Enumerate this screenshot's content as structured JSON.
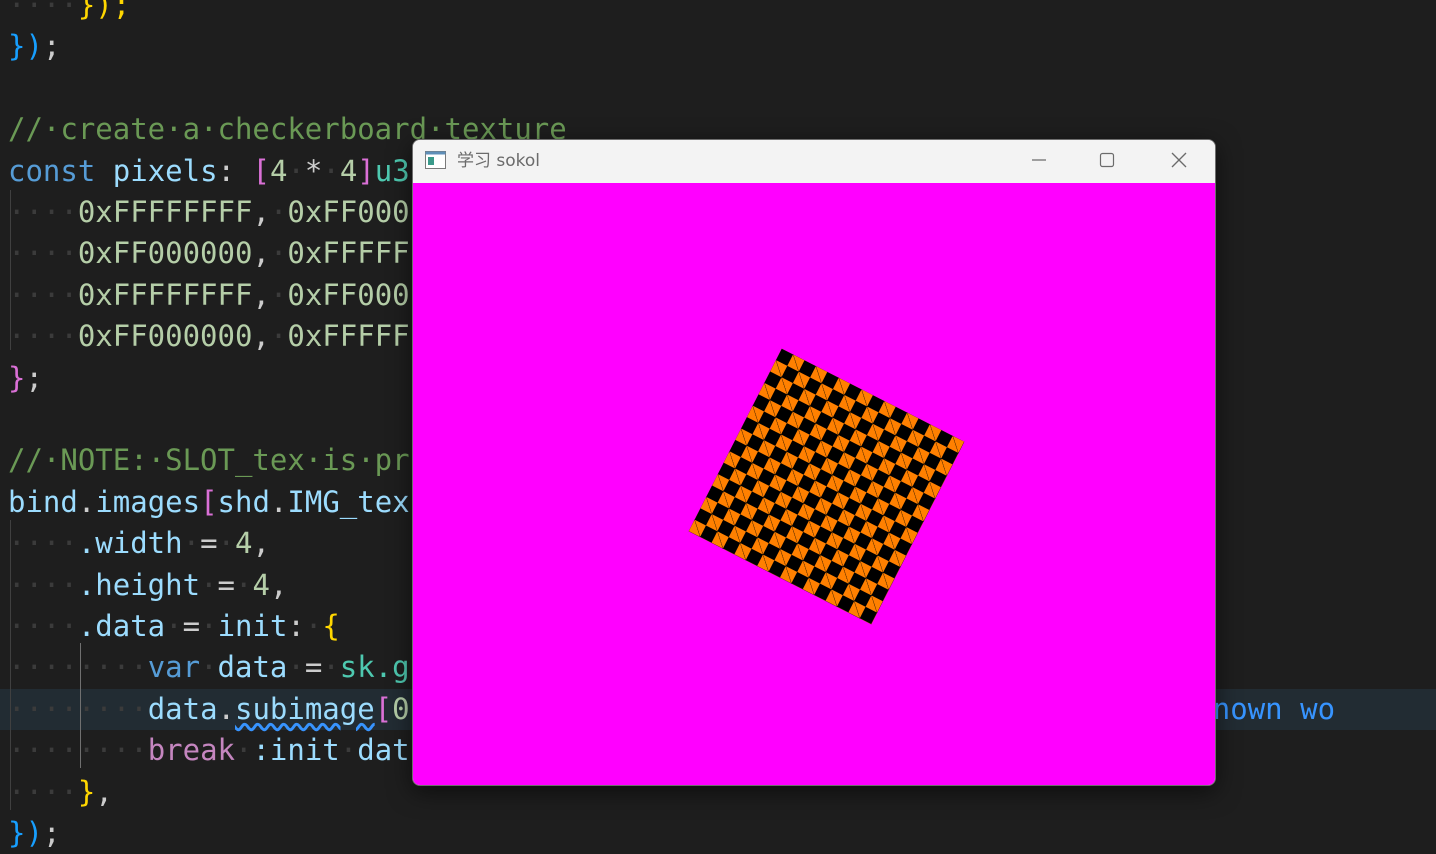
{
  "editor": {
    "lines": [
      [
        {
          "t": "····",
          "c": "ws"
        },
        {
          "t": "});",
          "c": "bracket-yellow"
        }
      ],
      [
        {
          "t": "}",
          "c": "bracket-blue"
        },
        {
          "t": ")",
          "c": "bracket-blue"
        },
        {
          "t": ";",
          "c": "punct"
        }
      ],
      [],
      [
        {
          "t": "//·create·a·checkerboard·texture",
          "c": "comment"
        }
      ],
      [
        {
          "t": "const",
          "c": "kw"
        },
        {
          "t": " ",
          "c": "ws"
        },
        {
          "t": "pixels",
          "c": "ident"
        },
        {
          "t": ":",
          "c": "punct"
        },
        {
          "t": " ",
          "c": "ws"
        },
        {
          "t": "[",
          "c": "bracket-pink"
        },
        {
          "t": "4",
          "c": "num"
        },
        {
          "t": "·",
          "c": "ws"
        },
        {
          "t": "*",
          "c": "punct"
        },
        {
          "t": "·",
          "c": "ws"
        },
        {
          "t": "4",
          "c": "num"
        },
        {
          "t": "]",
          "c": "bracket-pink"
        },
        {
          "t": "u3",
          "c": "type"
        }
      ],
      [
        {
          "t": "····",
          "c": "ws"
        },
        {
          "t": "0xFFFFFFFF",
          "c": "num"
        },
        {
          "t": ",",
          "c": "punct"
        },
        {
          "t": "·",
          "c": "ws"
        },
        {
          "t": "0xFF000",
          "c": "num"
        }
      ],
      [
        {
          "t": "····",
          "c": "ws"
        },
        {
          "t": "0xFF000000",
          "c": "num"
        },
        {
          "t": ",",
          "c": "punct"
        },
        {
          "t": "·",
          "c": "ws"
        },
        {
          "t": "0xFFFFF",
          "c": "num"
        }
      ],
      [
        {
          "t": "····",
          "c": "ws"
        },
        {
          "t": "0xFFFFFFFF",
          "c": "num"
        },
        {
          "t": ",",
          "c": "punct"
        },
        {
          "t": "·",
          "c": "ws"
        },
        {
          "t": "0xFF000",
          "c": "num"
        }
      ],
      [
        {
          "t": "····",
          "c": "ws"
        },
        {
          "t": "0xFF000000",
          "c": "num"
        },
        {
          "t": ",",
          "c": "punct"
        },
        {
          "t": "·",
          "c": "ws"
        },
        {
          "t": "0xFFFFF",
          "c": "num"
        }
      ],
      [
        {
          "t": "}",
          "c": "bracket-pink"
        },
        {
          "t": ";",
          "c": "punct"
        }
      ],
      [],
      [
        {
          "t": "//·NOTE:·SLOT_tex·is·pr",
          "c": "comment"
        }
      ],
      [
        {
          "t": "bind",
          "c": "ident"
        },
        {
          "t": ".",
          "c": "punct"
        },
        {
          "t": "images",
          "c": "ident"
        },
        {
          "t": "[",
          "c": "bracket-pink"
        },
        {
          "t": "shd",
          "c": "ident"
        },
        {
          "t": ".",
          "c": "punct"
        },
        {
          "t": "IMG_tex",
          "c": "ident"
        }
      ],
      [
        {
          "t": "····",
          "c": "ws"
        },
        {
          "t": ".width",
          "c": "ident"
        },
        {
          "t": "·",
          "c": "ws"
        },
        {
          "t": "=",
          "c": "punct"
        },
        {
          "t": "·",
          "c": "ws"
        },
        {
          "t": "4",
          "c": "num"
        },
        {
          "t": ",",
          "c": "punct"
        }
      ],
      [
        {
          "t": "····",
          "c": "ws"
        },
        {
          "t": ".height",
          "c": "ident"
        },
        {
          "t": "·",
          "c": "ws"
        },
        {
          "t": "=",
          "c": "punct"
        },
        {
          "t": "·",
          "c": "ws"
        },
        {
          "t": "4",
          "c": "num"
        },
        {
          "t": ",",
          "c": "punct"
        }
      ],
      [
        {
          "t": "····",
          "c": "ws"
        },
        {
          "t": ".data",
          "c": "ident"
        },
        {
          "t": "·",
          "c": "ws"
        },
        {
          "t": "=",
          "c": "punct"
        },
        {
          "t": "·",
          "c": "ws"
        },
        {
          "t": "init",
          "c": "ident"
        },
        {
          "t": ":",
          "c": "punct"
        },
        {
          "t": "·",
          "c": "ws"
        },
        {
          "t": "{",
          "c": "bracket-yellow"
        }
      ],
      [
        {
          "t": "········",
          "c": "ws"
        },
        {
          "t": "var",
          "c": "kw"
        },
        {
          "t": "·",
          "c": "ws"
        },
        {
          "t": "data",
          "c": "ident"
        },
        {
          "t": "·",
          "c": "ws"
        },
        {
          "t": "=",
          "c": "punct"
        },
        {
          "t": "·",
          "c": "ws"
        },
        {
          "t": "sk",
          "c": "type"
        },
        {
          "t": ".g",
          "c": "type"
        }
      ],
      [
        {
          "t": "········",
          "c": "ws"
        },
        {
          "t": "data",
          "c": "ident"
        },
        {
          "t": ".",
          "c": "punct"
        },
        {
          "t": "subimage",
          "c": "ident",
          "sq": true
        },
        {
          "t": "[",
          "c": "bracket-pink"
        },
        {
          "t": "0",
          "c": "num"
        },
        {
          "t": "                                        ",
          "c": "ws"
        },
        {
          "t": "\"",
          "c": "punct"
        },
        {
          "t": ":",
          "c": "error"
        },
        {
          "t": " ",
          "c": "ws"
        },
        {
          "t": "Unknown",
          "c": "error"
        },
        {
          "t": " ",
          "c": "ws"
        },
        {
          "t": "wo",
          "c": "error"
        }
      ],
      [
        {
          "t": "········",
          "c": "ws"
        },
        {
          "t": "break",
          "c": "ctrl"
        },
        {
          "t": "·",
          "c": "ws"
        },
        {
          "t": ":init",
          "c": "ident"
        },
        {
          "t": "·",
          "c": "ws"
        },
        {
          "t": "dat",
          "c": "ident"
        }
      ],
      [
        {
          "t": "····",
          "c": "ws"
        },
        {
          "t": "}",
          "c": "bracket-yellow"
        },
        {
          "t": ",",
          "c": "punct"
        }
      ],
      [
        {
          "t": "}",
          "c": "bracket-blue"
        },
        {
          "t": ")",
          "c": "bracket-blue"
        },
        {
          "t": ";",
          "c": "punct"
        }
      ]
    ],
    "current_line_index": 17
  },
  "window": {
    "title": "学习 sokol",
    "canvas_clear_color": "#ff00ff",
    "checker_colors": [
      "#ff8000",
      "#000000"
    ],
    "icons": {
      "app": "app-window-icon",
      "minimize": "minimize-icon",
      "maximize": "maximize-icon",
      "close": "close-icon"
    }
  }
}
